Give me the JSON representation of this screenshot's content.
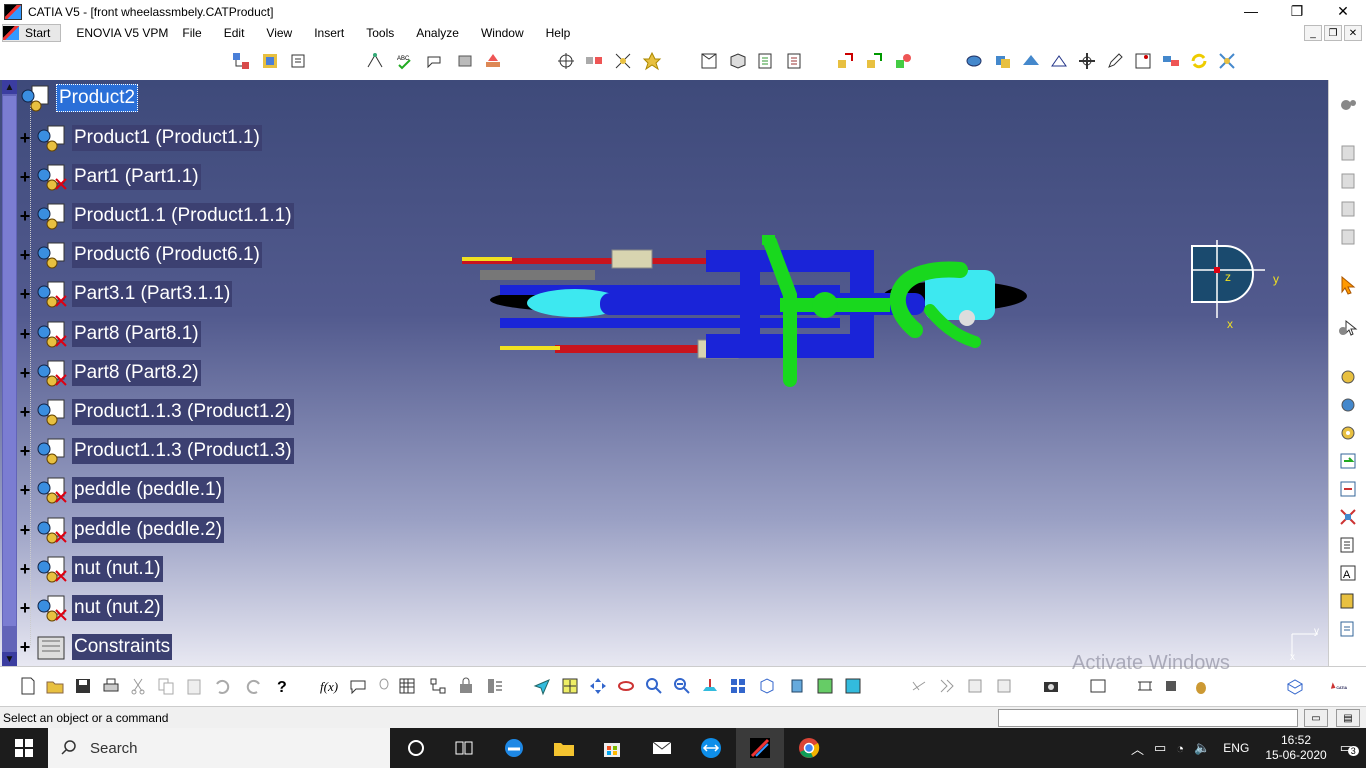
{
  "window": {
    "title": "CATIA V5 - [front wheelassmbely.CATProduct]",
    "minimize": "—",
    "maximize": "❐",
    "close": "✕"
  },
  "menu": {
    "start": "Start",
    "items": [
      "ENOVIA V5 VPM",
      "File",
      "Edit",
      "View",
      "Insert",
      "Tools",
      "Analyze",
      "Window",
      "Help"
    ],
    "mdi": [
      "_",
      "❐",
      "✕"
    ]
  },
  "tree": {
    "root": "Product2",
    "nodes": [
      {
        "label": "Product1 (Product1.1)",
        "kind": "product"
      },
      {
        "label": "Part1 (Part1.1)",
        "kind": "part"
      },
      {
        "label": "Product1.1 (Product1.1.1)",
        "kind": "product"
      },
      {
        "label": "Product6 (Product6.1)",
        "kind": "product"
      },
      {
        "label": "Part3.1 (Part3.1.1)",
        "kind": "part"
      },
      {
        "label": "Part8 (Part8.1)",
        "kind": "part"
      },
      {
        "label": "Part8 (Part8.2)",
        "kind": "part"
      },
      {
        "label": "Product1.1.3 (Product1.2)",
        "kind": "product"
      },
      {
        "label": "Product1.1.3 (Product1.3)",
        "kind": "product"
      },
      {
        "label": "peddle (peddle.1)",
        "kind": "part"
      },
      {
        "label": "peddle (peddle.2)",
        "kind": "part"
      },
      {
        "label": "nut (nut.1)",
        "kind": "part"
      },
      {
        "label": "nut (nut.2)",
        "kind": "part"
      },
      {
        "label": "Constraints",
        "kind": "constraints"
      }
    ]
  },
  "compass": {
    "z": "z",
    "y": "y",
    "x": "x"
  },
  "axis_corner": {
    "x": "x",
    "y": "y"
  },
  "status": {
    "text": "Select an object or a command",
    "watermark": "Activate Windows"
  },
  "taskbar": {
    "search_placeholder": "Search",
    "language": "ENG",
    "time": "16:52",
    "date": "15-06-2020",
    "notifications": "3"
  },
  "colors": {
    "viewport_top": "#3e4a7a",
    "viewport_bottom": "#e8e8f2",
    "tree_label_bg": "#3c4071",
    "tree_selected_bg": "#2a6fd8",
    "model_blue": "#1a24d8",
    "model_cyan": "#3de8f0",
    "model_green": "#19d81e",
    "model_red": "#c8141e",
    "model_yellow": "#f0e020"
  }
}
